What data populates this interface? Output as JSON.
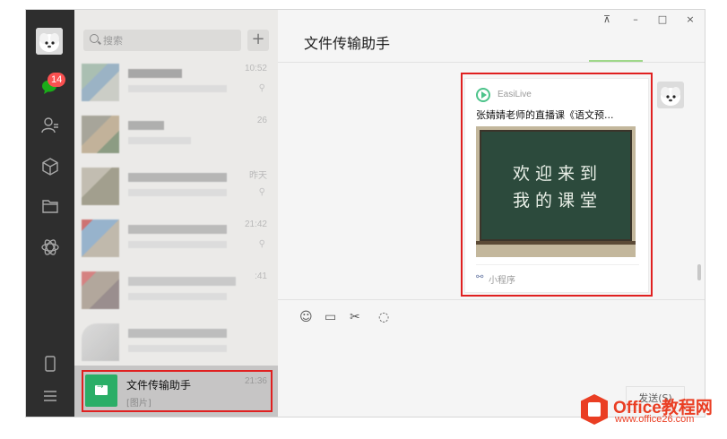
{
  "window": {
    "title": "文件传输助手",
    "controls": {
      "pin": "⊼",
      "minimize": "–",
      "maximize": "□",
      "close": "×"
    }
  },
  "rail": {
    "badge_count": "14"
  },
  "search": {
    "placeholder": "搜索",
    "add_label": "+"
  },
  "chats": [
    {
      "time": "10:52",
      "muted": true
    },
    {
      "time": "26",
      "muted": false
    },
    {
      "time": "昨天",
      "muted": true
    },
    {
      "time": "21:42",
      "muted": true
    },
    {
      "time": ":41",
      "muted": false
    },
    {
      "time": "",
      "muted": false
    }
  ],
  "active_chat": {
    "name": "文件传输助手",
    "last_message": "[图片]",
    "time": "21:36"
  },
  "card": {
    "app_name": "EasiLive",
    "title": "张婧婧老师的直播课《语文预...",
    "board_line1": "欢迎来到",
    "board_line2": "我的课堂",
    "footer_label": "小程序"
  },
  "toolbar": {
    "emoji": "☺",
    "folder": "▭",
    "scissors": "✂",
    "chat": "◌"
  },
  "send": {
    "label": "发送(S)"
  },
  "watermark": {
    "brand": "Office教程网",
    "url": "www.office26.com"
  },
  "colors": {
    "rail_bg": "#2e2e2e",
    "list_bg": "#ebeae8",
    "chat_bg": "#f5f5f5",
    "accent_green": "#2aae67",
    "highlight_red": "#e02020",
    "watermark_red": "#ea3e23"
  }
}
